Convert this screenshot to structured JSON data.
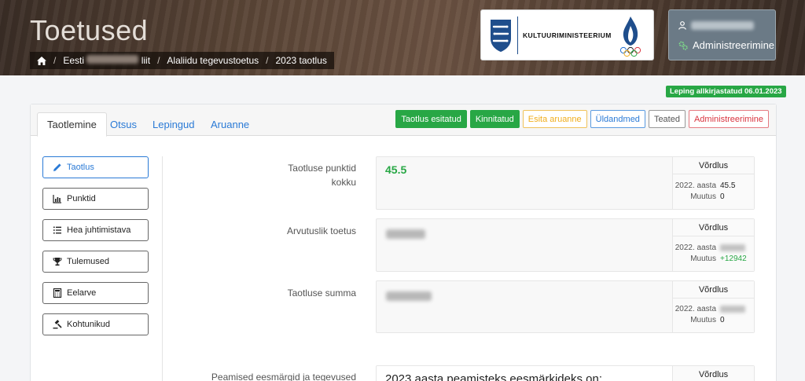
{
  "header": {
    "title": "Toetused",
    "breadcrumb": {
      "org_prefix": "Eesti",
      "org_suffix": "liit",
      "crumb2": "Alaliidu tegevustoetus",
      "crumb3": "2023 taotlus"
    },
    "ministry_name": "KULTUURIMINISTEERIUM",
    "user_menu": {
      "admin_label": "Administreerimine"
    }
  },
  "status_badge": "Leping allkirjastatud 06.01.2023",
  "tabs": [
    {
      "label": "Taotlemine",
      "active": true
    },
    {
      "label": "Otsus"
    },
    {
      "label": "Lepingud"
    },
    {
      "label": "Aruanne"
    }
  ],
  "actions": [
    {
      "label": "Taotlus esitatud",
      "style": "green"
    },
    {
      "label": "Kinnitatud",
      "style": "green"
    },
    {
      "label": "Esita aruanne",
      "style": "warn"
    },
    {
      "label": "Üldandmed",
      "style": "info"
    },
    {
      "label": "Teated",
      "style": "gray"
    },
    {
      "label": "Administreerimine",
      "style": "red"
    }
  ],
  "sidebar": [
    {
      "label": "Taotlus",
      "icon": "pencil-icon",
      "active": true
    },
    {
      "label": "Punktid",
      "icon": "bar-chart-icon"
    },
    {
      "label": "Hea juhtimistava",
      "icon": "list-icon"
    },
    {
      "label": "Tulemused",
      "icon": "trophy-icon"
    },
    {
      "label": "Eelarve",
      "icon": "calculator-icon"
    },
    {
      "label": "Kohtunikud",
      "icon": "gavel-icon"
    }
  ],
  "rows": [
    {
      "label_line1": "Taotluse punktid",
      "label_line2": "kokku",
      "value": "45.5",
      "compare_title": "Võrdlus",
      "year_label": "2022. aasta",
      "year_value": "45.5",
      "change_label": "Muutus",
      "change_value": "0"
    },
    {
      "label_line1": "Arvutuslik toetus",
      "compare_title": "Võrdlus",
      "year_label": "2022. aasta",
      "change_label": "Muutus",
      "change_value": "+12942"
    },
    {
      "label_line1": "Taotluse summa",
      "compare_title": "Võrdlus",
      "year_label": "2022. aasta",
      "change_label": "Muutus",
      "change_value": "0"
    },
    {
      "label_line1": "Peamised eesmärgid ja tegevused",
      "value": "2023 aasta peamisteks eesmärkideks on:",
      "compare_title": "Võrdlus"
    }
  ],
  "colors": {
    "success": "#28a745",
    "link": "#2a7ad6",
    "danger": "#d9343f",
    "warning": "#f0ad1c"
  }
}
